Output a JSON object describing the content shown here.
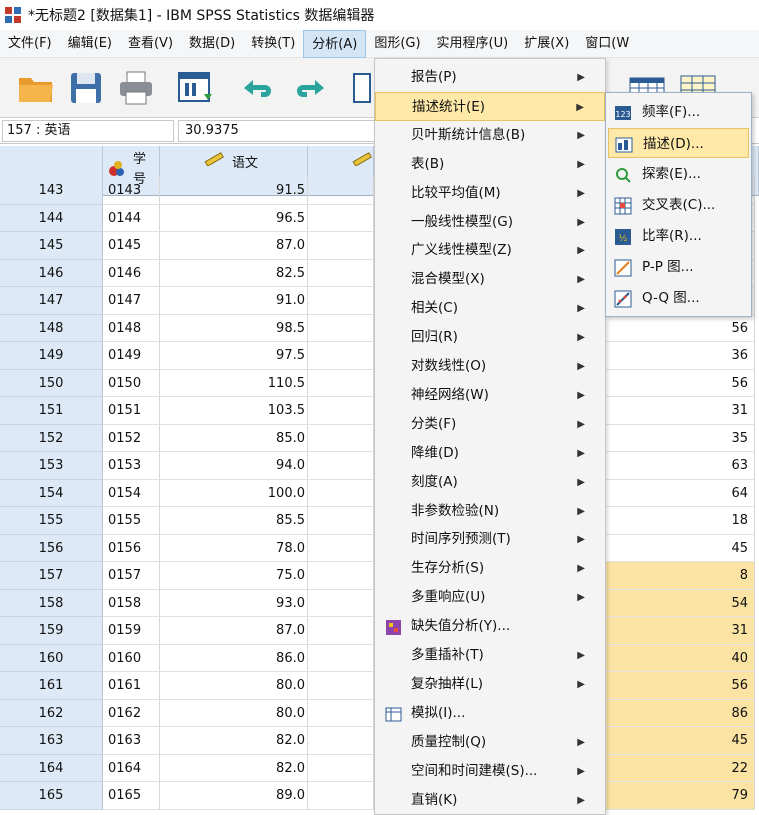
{
  "window": {
    "title": "*无标题2 [数据集1] - IBM SPSS Statistics 数据编辑器"
  },
  "menubar": [
    {
      "label": "文件(F)"
    },
    {
      "label": "编辑(E)"
    },
    {
      "label": "查看(V)"
    },
    {
      "label": "数据(D)"
    },
    {
      "label": "转换(T)"
    },
    {
      "label": "分析(A)"
    },
    {
      "label": "图形(G)"
    },
    {
      "label": "实用程序(U)"
    },
    {
      "label": "扩展(X)"
    },
    {
      "label": "窗口(W"
    }
  ],
  "toolbar": {
    "buttons": [
      "open-folder-icon",
      "save-icon",
      "print-icon",
      "dialog-recall-icon",
      "undo-icon",
      "redo-icon"
    ]
  },
  "cellbar": {
    "reference": "157 : 英语",
    "value": "30.9375"
  },
  "grid": {
    "columns": [
      {
        "name": "学号",
        "icon": "nominal-icon"
      },
      {
        "name": "语文",
        "icon": "scale-ruler-icon"
      }
    ],
    "rows": [
      {
        "n": "143",
        "id": "0143",
        "score": "91.5",
        "right": ""
      },
      {
        "n": "144",
        "id": "0144",
        "score": "96.5",
        "right": ""
      },
      {
        "n": "145",
        "id": "0145",
        "score": "87.0",
        "right": ""
      },
      {
        "n": "146",
        "id": "0146",
        "score": "82.5",
        "right": ""
      },
      {
        "n": "147",
        "id": "0147",
        "score": "91.0",
        "right": ""
      },
      {
        "n": "148",
        "id": "0148",
        "score": "98.5",
        "right": "56"
      },
      {
        "n": "149",
        "id": "0149",
        "score": "97.5",
        "right": "36"
      },
      {
        "n": "150",
        "id": "0150",
        "score": "110.5",
        "right": "56"
      },
      {
        "n": "151",
        "id": "0151",
        "score": "103.5",
        "right": "31"
      },
      {
        "n": "152",
        "id": "0152",
        "score": "85.0",
        "right": "35"
      },
      {
        "n": "153",
        "id": "0153",
        "score": "94.0",
        "right": "63"
      },
      {
        "n": "154",
        "id": "0154",
        "score": "100.0",
        "right": "64"
      },
      {
        "n": "155",
        "id": "0155",
        "score": "85.5",
        "right": "18"
      },
      {
        "n": "156",
        "id": "0156",
        "score": "78.0",
        "right": "45"
      },
      {
        "n": "157",
        "id": "0157",
        "score": "75.0",
        "right": "8"
      },
      {
        "n": "158",
        "id": "0158",
        "score": "93.0",
        "right": "54"
      },
      {
        "n": "159",
        "id": "0159",
        "score": "87.0",
        "right": "31"
      },
      {
        "n": "160",
        "id": "0160",
        "score": "86.0",
        "right": "40"
      },
      {
        "n": "161",
        "id": "0161",
        "score": "80.0",
        "right": "56"
      },
      {
        "n": "162",
        "id": "0162",
        "score": "80.0",
        "right": "86"
      },
      {
        "n": "163",
        "id": "0163",
        "score": "82.0",
        "right": "45"
      },
      {
        "n": "164",
        "id": "0164",
        "score": "82.0",
        "right": "22"
      },
      {
        "n": "165",
        "id": "0165",
        "score": "89.0",
        "right": "79"
      }
    ]
  },
  "analyze_menu": {
    "items": [
      {
        "label": "报告(P)",
        "submenu": true
      },
      {
        "label": "描述统计(E)",
        "submenu": true
      },
      {
        "label": "贝叶斯统计信息(B)",
        "submenu": true
      },
      {
        "label": "表(B)",
        "submenu": true
      },
      {
        "label": "比较平均值(M)",
        "submenu": true
      },
      {
        "label": "一般线性模型(G)",
        "submenu": true
      },
      {
        "label": "广义线性模型(Z)",
        "submenu": true
      },
      {
        "label": "混合模型(X)",
        "submenu": true
      },
      {
        "label": "相关(C)",
        "submenu": true
      },
      {
        "label": "回归(R)",
        "submenu": true
      },
      {
        "label": "对数线性(O)",
        "submenu": true
      },
      {
        "label": "神经网络(W)",
        "submenu": true
      },
      {
        "label": "分类(F)",
        "submenu": true
      },
      {
        "label": "降维(D)",
        "submenu": true
      },
      {
        "label": "刻度(A)",
        "submenu": true
      },
      {
        "label": "非参数检验(N)",
        "submenu": true
      },
      {
        "label": "时间序列预测(T)",
        "submenu": true
      },
      {
        "label": "生存分析(S)",
        "submenu": true
      },
      {
        "label": "多重响应(U)",
        "submenu": true
      },
      {
        "label": "缺失值分析(Y)...",
        "submenu": false
      },
      {
        "label": "多重插补(T)",
        "submenu": true
      },
      {
        "label": "复杂抽样(L)",
        "submenu": true
      },
      {
        "label": "模拟(I)...",
        "submenu": false
      },
      {
        "label": "质量控制(Q)",
        "submenu": true
      },
      {
        "label": "空间和时间建模(S)...",
        "submenu": true
      },
      {
        "label": "直销(K)",
        "submenu": true
      }
    ]
  },
  "descriptives_submenu": {
    "items": [
      {
        "label": "频率(F)..."
      },
      {
        "label": "描述(D)..."
      },
      {
        "label": "探索(E)..."
      },
      {
        "label": "交叉表(C)..."
      },
      {
        "label": "比率(R)..."
      },
      {
        "label": "P-P 图..."
      },
      {
        "label": "Q-Q 图..."
      }
    ]
  },
  "colors": {
    "highlight": "#fbe3a4",
    "menu_active": "#ffe9a8",
    "header_bg": "#dde9f6"
  }
}
